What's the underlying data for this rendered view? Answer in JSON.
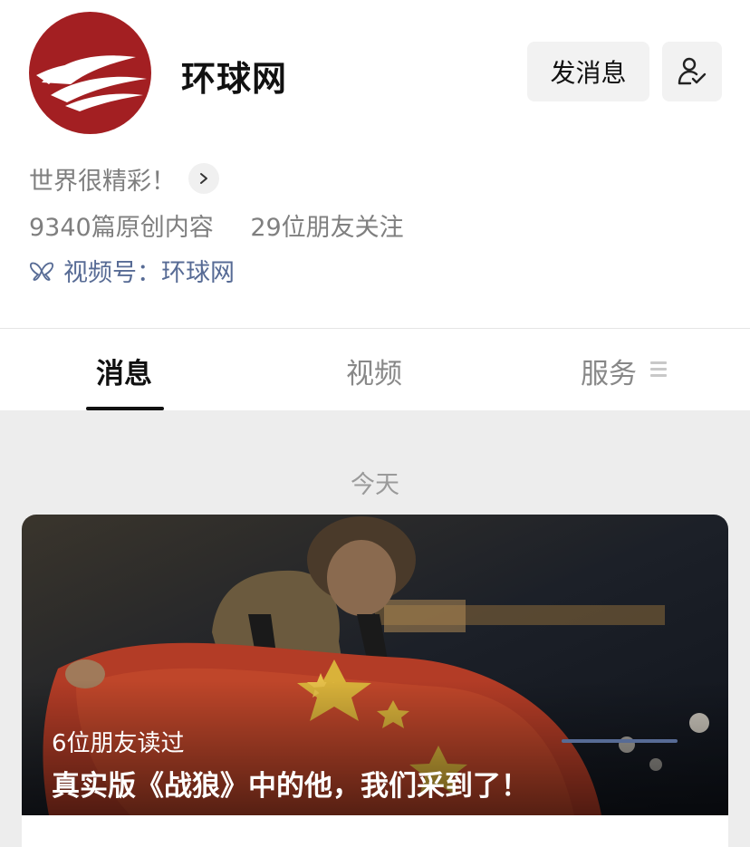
{
  "account": {
    "name": "环球网",
    "description": "世界很精彩！",
    "stats": {
      "original_articles": "9340篇原创内容",
      "friends_following": "29位朋友关注"
    },
    "channels_link": "视频号：环球网",
    "brand_color": "#a31f22"
  },
  "actions": {
    "message_button": "发消息",
    "follow_icon": "user-check-icon"
  },
  "tabs": [
    {
      "label": "消息",
      "active": true
    },
    {
      "label": "视频",
      "active": false
    },
    {
      "label": "服务",
      "active": false
    }
  ],
  "feed": {
    "date_label": "今天",
    "articles": [
      {
        "read_by": "6位朋友读过",
        "title": "真实版《战狼》中的他，我们采到了！"
      }
    ]
  },
  "colors": {
    "link": "#576b95",
    "feed_background": "#ededed"
  }
}
